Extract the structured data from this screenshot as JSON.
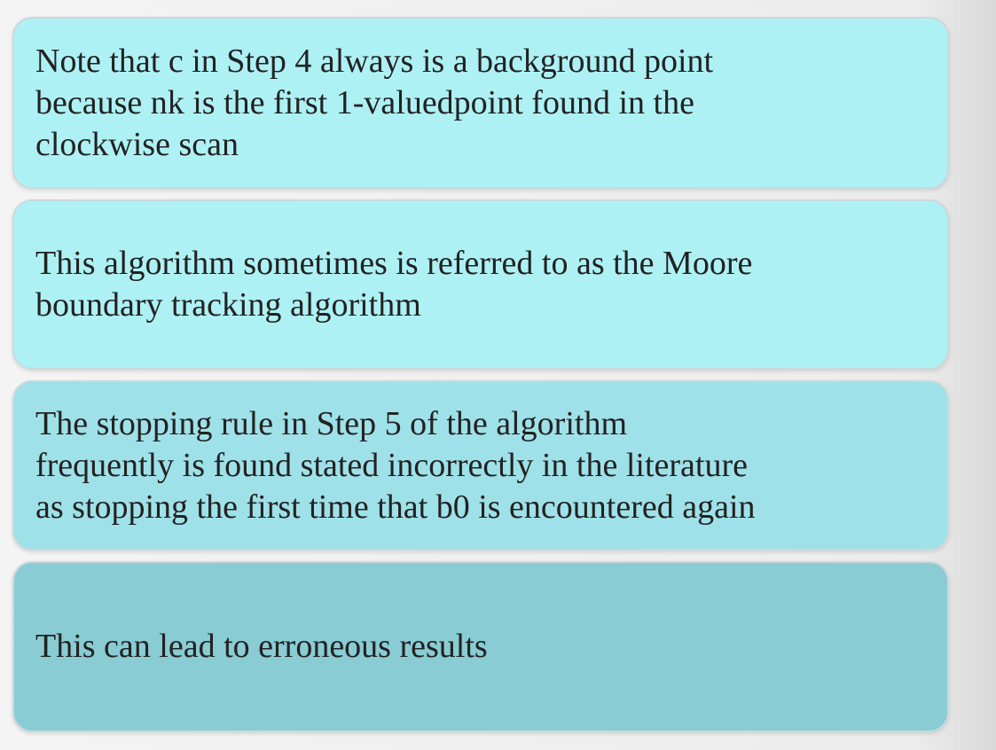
{
  "cards": [
    {
      "text": "Note that c in Step 4 always is a background point\nbecause nk is the first 1-valuedpoint found in the\nclockwise scan"
    },
    {
      "text": "This algorithm sometimes is referred to as the Moore\nboundary tracking algorithm"
    },
    {
      "text": "The stopping rule in Step 5 of the algorithm\nfrequently is found stated incorrectly in the literature\nas stopping the first time that b0 is encountered again"
    },
    {
      "text": "This can lead to erroneous results"
    }
  ],
  "colors": {
    "card_1_bg": "#aef1f5",
    "card_2_bg": "#aef1f5",
    "card_3_bg": "#9fe1e8",
    "card_4_bg": "#89ccd4",
    "text": "#222222"
  }
}
